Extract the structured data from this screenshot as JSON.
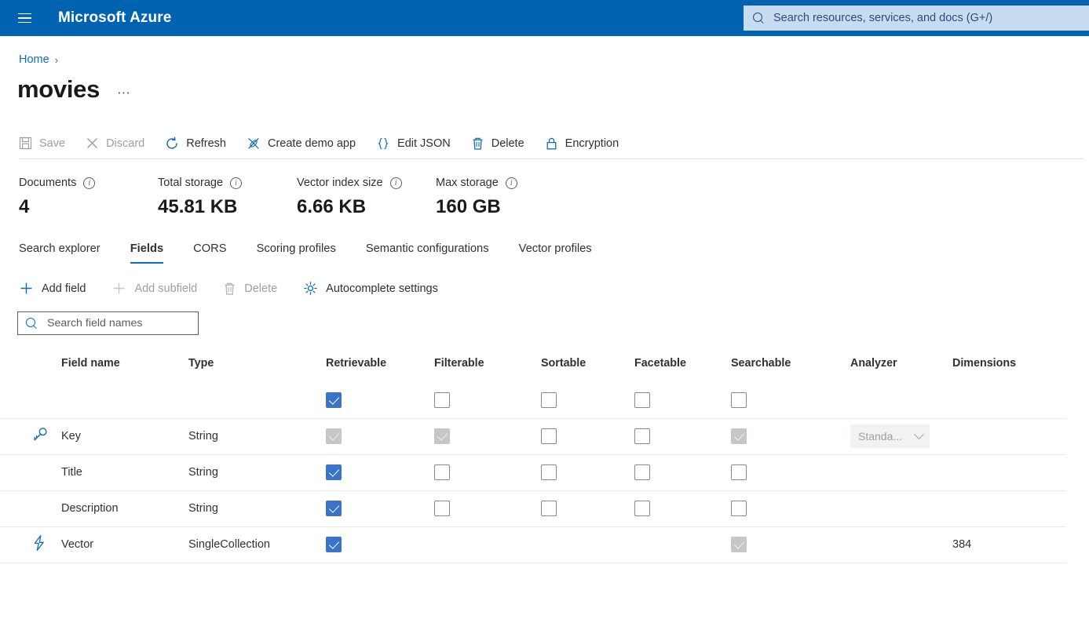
{
  "topbar": {
    "menu_icon": "hamburger-icon",
    "brand": "Microsoft Azure",
    "search_icon": "search-icon",
    "search_placeholder": "Search resources, services, and docs (G+/)"
  },
  "breadcrumb": {
    "home": "Home",
    "separator": "›"
  },
  "header": {
    "title": "movies",
    "more_label": "⋯"
  },
  "toolbar": {
    "items": [
      {
        "label": "Save",
        "icon": "save-icon",
        "disabled": true
      },
      {
        "label": "Discard",
        "icon": "discard-icon",
        "disabled": true
      },
      {
        "label": "Refresh",
        "icon": "refresh-icon",
        "disabled": false
      },
      {
        "label": "Create demo app",
        "icon": "demo-app-icon",
        "disabled": false
      },
      {
        "label": "Edit JSON",
        "icon": "braces-icon",
        "disabled": false
      },
      {
        "label": "Delete",
        "icon": "trash-icon",
        "disabled": false
      },
      {
        "label": "Encryption",
        "icon": "lock-icon",
        "disabled": false
      }
    ]
  },
  "stats": [
    {
      "label": "Documents",
      "value": "4",
      "info_icon": "info-icon"
    },
    {
      "label": "Total storage",
      "value": "45.81 KB",
      "info_icon": "info-icon"
    },
    {
      "label": "Vector index size",
      "value": "6.66 KB",
      "info_icon": "info-icon"
    },
    {
      "label": "Max storage",
      "value": "160 GB",
      "info_icon": "info-icon"
    }
  ],
  "tabs": [
    {
      "label": "Search explorer",
      "active": false
    },
    {
      "label": "Fields",
      "active": true
    },
    {
      "label": "CORS",
      "active": false
    },
    {
      "label": "Scoring profiles",
      "active": false
    },
    {
      "label": "Semantic configurations",
      "active": false
    },
    {
      "label": "Vector profiles",
      "active": false
    }
  ],
  "fields_toolbar": {
    "items": [
      {
        "label": "Add field",
        "icon": "plus-icon",
        "disabled": false
      },
      {
        "label": "Add subfield",
        "icon": "plus-icon",
        "disabled": true
      },
      {
        "label": "Delete",
        "icon": "trash-icon",
        "disabled": true
      },
      {
        "label": "Autocomplete settings",
        "icon": "gear-icon",
        "disabled": false
      }
    ]
  },
  "field_search": {
    "icon": "search-icon",
    "placeholder": "Search field names",
    "value": ""
  },
  "table": {
    "columns": [
      "Field name",
      "Type",
      "Retrievable",
      "Filterable",
      "Sortable",
      "Facetable",
      "Searchable",
      "Analyzer",
      "Dimensions"
    ],
    "header_row": {
      "retrievable": "checked",
      "filterable": "unchecked",
      "sortable": "unchecked",
      "facetable": "unchecked",
      "searchable": "unchecked"
    },
    "rows": [
      {
        "icon": "key-icon",
        "name": "Key",
        "type": "String",
        "retrievable": "disabled-checked",
        "filterable": "disabled-checked",
        "sortable": "unchecked",
        "facetable": "unchecked",
        "searchable": "disabled-checked",
        "analyzer": "Standa...",
        "dimensions": ""
      },
      {
        "icon": "",
        "name": "Title",
        "type": "String",
        "retrievable": "checked",
        "filterable": "unchecked",
        "sortable": "unchecked",
        "facetable": "unchecked",
        "searchable": "unchecked",
        "analyzer": "",
        "dimensions": ""
      },
      {
        "icon": "",
        "name": "Description",
        "type": "String",
        "retrievable": "checked",
        "filterable": "unchecked",
        "sortable": "unchecked",
        "facetable": "unchecked",
        "searchable": "unchecked",
        "analyzer": "",
        "dimensions": ""
      },
      {
        "icon": "lightning-icon",
        "name": "Vector",
        "type": "SingleCollection",
        "retrievable": "checked",
        "filterable": "none",
        "sortable": "none",
        "facetable": "none",
        "searchable": "disabled-checked",
        "analyzer": "",
        "dimensions": "384"
      }
    ]
  },
  "colors": {
    "azure_blue": "#0063b1",
    "accent": "#0f6cbd",
    "checkbox_checked": "#3a74c8",
    "checkbox_disabled": "#c8c6c4"
  }
}
